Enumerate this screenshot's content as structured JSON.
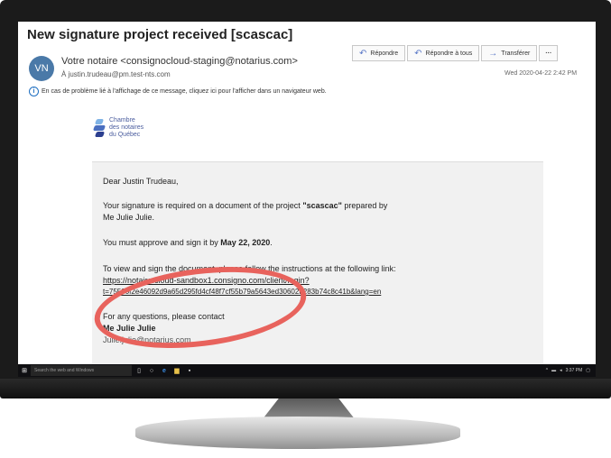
{
  "email": {
    "subject": "New signature project received [scascac]",
    "avatar_initials": "VN",
    "sender": "Votre notaire <consignocloud-staging@notarius.com>",
    "recipient": "À justin.trudeau@pm.test-nts.com",
    "info_message": "En cas de problème lié à l'affichage de ce message, cliquez ici pour l'afficher dans un navigateur web.",
    "date": "Wed 2020-04-22 2:42 PM",
    "actions": {
      "reply": "Répondre",
      "reply_all": "Répondre à tous",
      "forward": "Transférer",
      "more": "···"
    }
  },
  "logo": {
    "line1": "Chambre",
    "line2": "des notaires",
    "line3": "du Québec"
  },
  "body": {
    "greeting": "Dear Justin Trudeau,",
    "signature_required_1": "Your signature is required on a document of the project ",
    "project_name": "\"scascac\"",
    "signature_required_2": " prepared by",
    "prepared_by": "Me Julie Julie.",
    "approve_prefix": "You must approve and sign it by ",
    "deadline": "May 22, 2020",
    "approve_suffix": ".",
    "instructions": "To view and sign the document, please follow the instructions at the following link:",
    "link_line1": "https://notaire.cloud-sandbox1.consigno.com/client/login?",
    "link_line2": "t=75500f2e46092d9a65d295fd4cf48f7cf55b79a5643ed30602b283b74c8c41b&lang=en",
    "questions": "For any questions, please contact",
    "contact_name": "Me Julie Julie",
    "contact_email": "Julie.julie@notarius.com"
  },
  "taskbar": {
    "search_placeholder": "Search the web and Windows",
    "clock": "3:37 PM"
  },
  "colors": {
    "accent": "#2a45c4",
    "highlight_circle": "#e8635d",
    "avatar_bg": "#4a79a8"
  }
}
